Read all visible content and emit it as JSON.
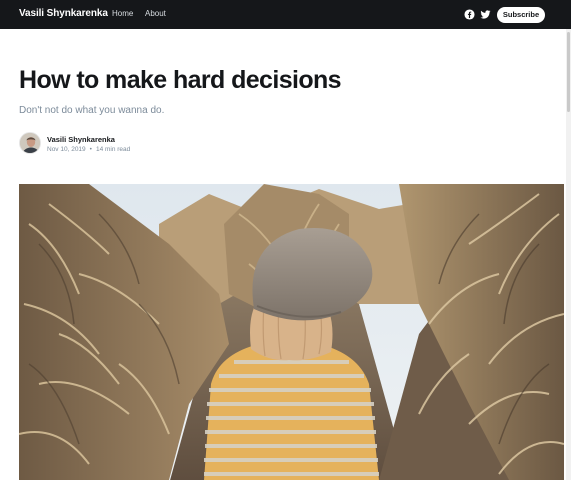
{
  "header": {
    "brand": "Vasili Shynkarenka",
    "nav": [
      {
        "label": "Home"
      },
      {
        "label": "About"
      }
    ],
    "social_icons": [
      "facebook-icon",
      "twitter-icon"
    ],
    "subscribe_label": "Subscribe"
  },
  "post": {
    "title": "How to make hard decisions",
    "excerpt": "Don't not do what you wanna do.",
    "author": "Vasili Shynkarenka",
    "date": "Nov 10, 2019",
    "separator": "•",
    "reading_time": "14 min read"
  },
  "colors": {
    "header_bg": "#15171a",
    "text_muted": "#7c8b9a",
    "button_bg": "#ffffff"
  }
}
